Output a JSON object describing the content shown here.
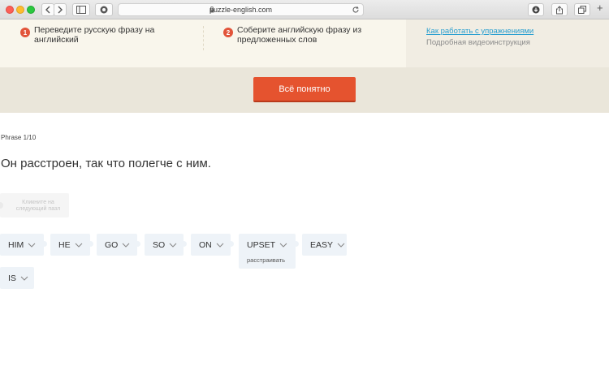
{
  "browser": {
    "url": "puzzle-english.com",
    "nav_back_icon": "chevron-left-icon",
    "nav_forward_icon": "chevron-right-icon",
    "new_tab_label": "+"
  },
  "instructions": {
    "step1_number": "1",
    "step1_text": "Переведите русскую фразу на английский",
    "step2_number": "2",
    "step2_text": "Соберите английскую фразу из предложенных слов",
    "help_link": "Как работать с упражнениями",
    "video_text": "Подробная видеоинструкция"
  },
  "confirm_button": "Всё понятно",
  "exercise": {
    "counter": "Phrase 1/10",
    "phrase": "Он расстроен, так что полегче с ним.",
    "slot_hint": "Кликните на следующий пазл",
    "words": [
      "HIM",
      "HE",
      "GO",
      "SO",
      "ON",
      "UPSET",
      "EASY",
      "IS"
    ],
    "upset_tooltip": "расстраивать"
  },
  "colors": {
    "accent": "#e5532f",
    "link": "#2a9fd0",
    "word_bg": "#eef3f8"
  }
}
